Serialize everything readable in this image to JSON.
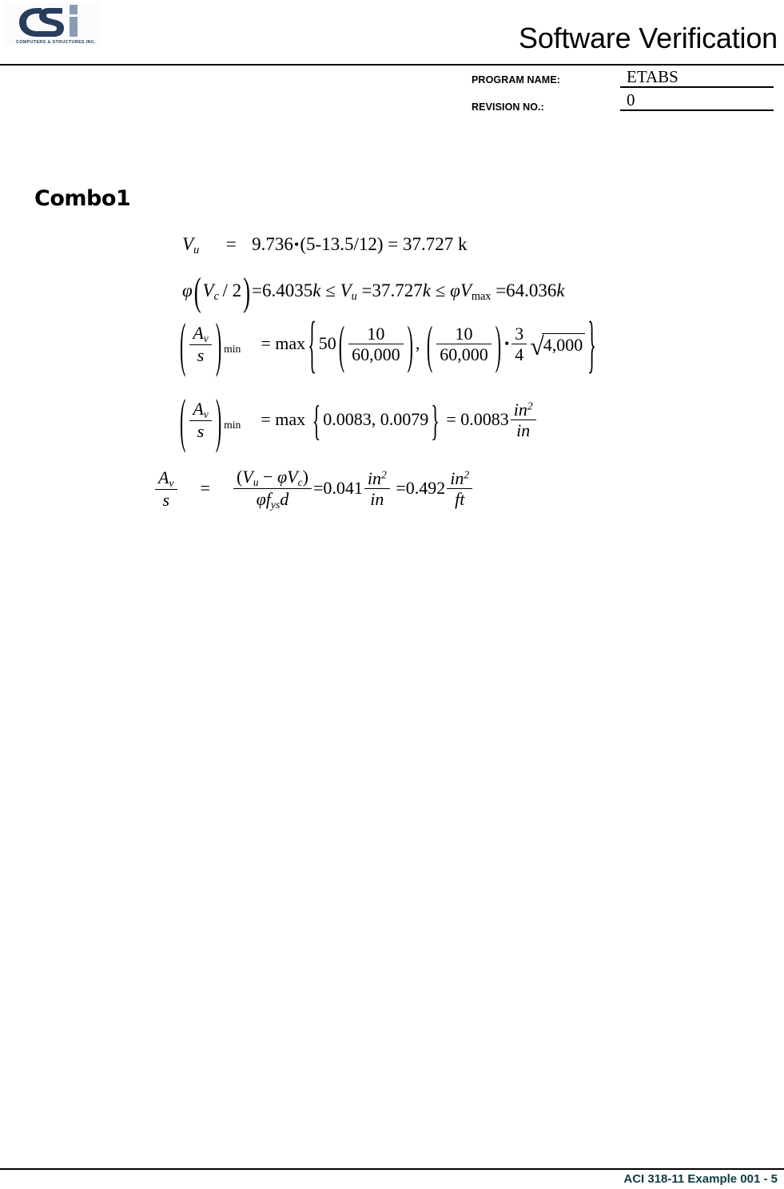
{
  "document": {
    "title": "Software Verification",
    "background_color": "#ffffff",
    "text_color": "#000000"
  },
  "logo": {
    "wordmark": "CSi",
    "tagline": "COMPUTERS & STRUCTURES INC.",
    "dark_color": "#283d5b",
    "light_color": "#8c9bb5"
  },
  "header": {
    "title": "Software Verification",
    "program_name_label": "PROGRAM NAME:",
    "program_name_value": "ETABS",
    "revision_label": "REVISION NO.:",
    "revision_value": "0"
  },
  "body": {
    "section_heading": "Combo1",
    "equations": [
      {
        "id": "eq-vu",
        "text": "Vu  =  9.736•(5-13.5/12) = 37.727 k",
        "parts": {
          "lhs": "V",
          "lhs_sub": "u",
          "eq1": "=",
          "value": "9.736",
          "dot": "•",
          "expr": "(5-13.5/12)",
          "eq2": "=",
          "result": "37.727",
          "unit": "k"
        }
      },
      {
        "id": "eq-shear-check",
        "text": "φ(Vc / 2) = 6.4035 k ≤ Vu = 37.727 k ≤ φVmax = 64.036 k",
        "parts": {
          "phi": "φ",
          "paren_open": "(",
          "vc": "V",
          "vc_sub": "c",
          "slash2": "/ 2",
          "paren_close": ")",
          "eq1": "=",
          "val1": "6.4035",
          "unit1": "k",
          "le1": "≤",
          "vu": "V",
          "vu_sub": "u",
          "eq2": "=",
          "val2": "37.727",
          "unit2": "k",
          "le2": "≤",
          "phi2": "φ",
          "vmax": "V",
          "vmax_sub": "max",
          "eq3": "=",
          "val3": "64.036",
          "unit3": "k"
        }
      },
      {
        "id": "eq-av-s-min-expression",
        "text": "(Av/s)min = max{50(10/60,000), (10/60,000)•(3/4)√(4,000)}",
        "parts": {
          "av": "A",
          "av_sub": "v",
          "s": "s",
          "min_sub": "min",
          "eq": "=",
          "max": "max",
          "fifty": "50",
          "num1": "10",
          "den1": "60,000",
          "comma": ",",
          "num2": "10",
          "den2": "60,000",
          "dot": "•",
          "num3": "3",
          "den3": "4",
          "radicand": "4,000"
        }
      },
      {
        "id": "eq-av-s-min-result",
        "text": "(Av/s)min = max{0.0083, 0.0079} = 0.0083 in²/in",
        "parts": {
          "av": "A",
          "av_sub": "v",
          "s": "s",
          "min_sub": "min",
          "eq1": "=",
          "max": "max",
          "val_a": "0.0083",
          "comma": ",",
          "val_b": "0.0079",
          "eq2": "=",
          "result": "0.0083",
          "unit_num": "in",
          "unit_num_sup": "2",
          "unit_den": "in"
        }
      },
      {
        "id": "eq-av-s-required",
        "text": "Av/s = (Vu − φVc)/(φ fys d) = 0.041 in²/in = 0.492 in²/ft",
        "parts": {
          "av": "A",
          "av_sub": "v",
          "s": "s",
          "eq1": "=",
          "num_open": "(",
          "vu": "V",
          "vu_sub": "u",
          "minus": "−",
          "phi": "φ",
          "vc": "V",
          "vc_sub": "c",
          "num_close": ")",
          "den_phi": "φ",
          "den_f": "f",
          "den_f_sub": "ys",
          "den_d": "d",
          "eq2": "=",
          "val1": "0.041",
          "unit1_num": "in",
          "unit1_sup": "2",
          "unit1_den": "in",
          "eq3": "=",
          "val2": "0.492",
          "unit2_num": "in",
          "unit2_sup": "2",
          "unit2_den": "ft"
        }
      }
    ]
  },
  "footer": {
    "text": "ACI 318-11 Example 001 - 5",
    "color": "#0e3b44"
  }
}
